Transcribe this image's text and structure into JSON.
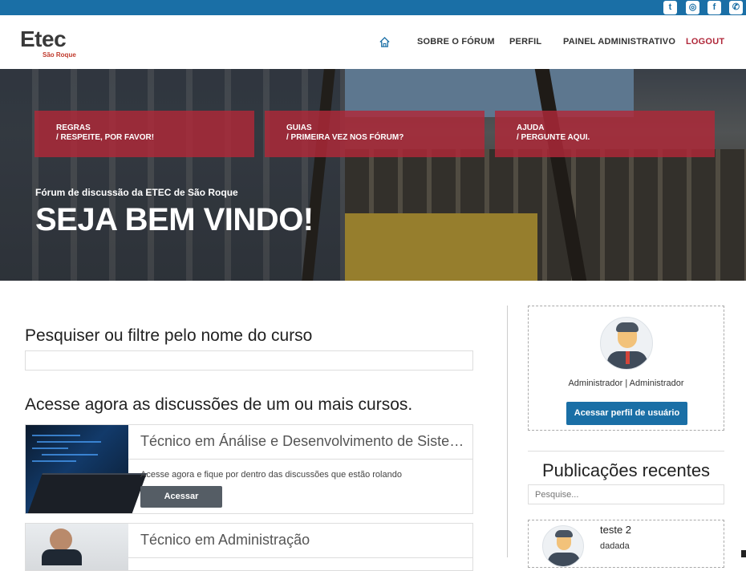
{
  "topbar": {
    "social": [
      {
        "name": "twitter-icon",
        "glyph": "t"
      },
      {
        "name": "instagram-icon",
        "glyph": "◎"
      },
      {
        "name": "facebook-icon",
        "glyph": "f"
      },
      {
        "name": "whatsapp-icon",
        "glyph": "✆"
      }
    ],
    "color": "#1a6fa6"
  },
  "header": {
    "logo_main": "Etec",
    "logo_sub": "São Roque",
    "nav": {
      "home_icon": "home-icon",
      "sobre": "SOBRE O FÓRUM",
      "perfil": "PERFIL",
      "painel": "PAINEL ADMINISTRATIVO",
      "logout": "LOGOUT"
    }
  },
  "hero": {
    "cards": [
      {
        "line1": "REGRAS",
        "line2": "/ RESPEITE, POR FAVOR!"
      },
      {
        "line1": "GUIAS",
        "line2": "/ PRIMEIRA VEZ NOS FÓRUM?"
      },
      {
        "line1": "AJUDA",
        "line2": "/ PERGUNTE AQUI."
      }
    ],
    "subtitle": "Fórum de discussão da ETEC de São Roque",
    "title": "SEJA BEM VINDO!"
  },
  "main": {
    "search_heading": "Pesquiser ou filtre pelo nome do curso",
    "search_value": "",
    "access_heading": "Acesse agora as discussões de um ou mais cursos.",
    "courses": [
      {
        "title": "Técnico em Ánálise e Desenvolvimento de Sistemas",
        "description": "Acesse agora e fique por dentro das discussões que estão rolando",
        "button": "Acessar"
      },
      {
        "title": "Técnico em Administração"
      }
    ]
  },
  "sidebar": {
    "profile_name": "Administrador | Administrador",
    "profile_button": "Acessar perfil de usuário",
    "recent_title": "Publicações recentes",
    "recent_search_placeholder": "Pesquise...",
    "posts": [
      {
        "title": "teste 2",
        "text": "dadada"
      }
    ]
  },
  "colors": {
    "primary": "#1a6fa6",
    "hero_card": "#b02838",
    "logout": "#b0283a",
    "button_dark": "#555d65"
  }
}
